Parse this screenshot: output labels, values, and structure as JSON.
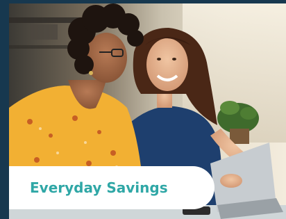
{
  "card": {
    "title": "Everyday Savings",
    "image_alt": "Two smiling women sitting together looking at a laptop",
    "colors": {
      "frame": "#17384f",
      "title_text": "#2fa7a6",
      "banner": "#ffffff"
    }
  }
}
